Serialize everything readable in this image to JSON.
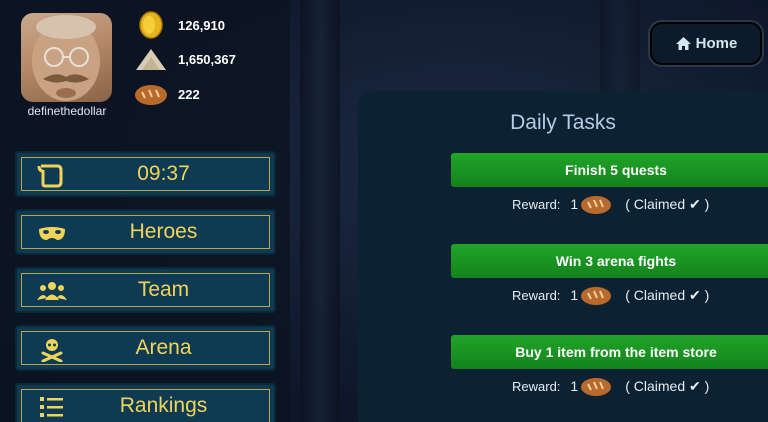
{
  "user": {
    "name": "definethedollar"
  },
  "resources": [
    {
      "icon": "gold-coin-icon",
      "value": "126,910"
    },
    {
      "icon": "sand-pile-icon",
      "value": "1,650,367"
    },
    {
      "icon": "bread-icon",
      "value": "222"
    }
  ],
  "menu": [
    {
      "icon": "scroll-icon",
      "label": "09:37"
    },
    {
      "icon": "mask-icon",
      "label": "Heroes"
    },
    {
      "icon": "team-icon",
      "label": "Team"
    },
    {
      "icon": "skull-crossbones-icon",
      "label": "Arena"
    },
    {
      "icon": "list-icon",
      "label": "Rankings"
    }
  ],
  "home": {
    "label": "Home",
    "icon": "home-icon"
  },
  "daily_tasks": {
    "title": "Daily Tasks",
    "reward_label": "Reward:",
    "tasks": [
      {
        "name": "Finish 5 quests",
        "reward_qty": "1",
        "reward_icon": "bread-icon",
        "status": "( Claimed ✔ )"
      },
      {
        "name": "Win 3 arena fights",
        "reward_qty": "1",
        "reward_icon": "bread-icon",
        "status": "( Claimed ✔ )"
      },
      {
        "name": "Buy 1 item from the item store",
        "reward_qty": "1",
        "reward_icon": "bread-icon",
        "status": "( Claimed ✔ )"
      }
    ]
  },
  "colors": {
    "menu_text": "#f0d45a",
    "task_button": "#1a9a22",
    "panel": "#0c2232"
  }
}
